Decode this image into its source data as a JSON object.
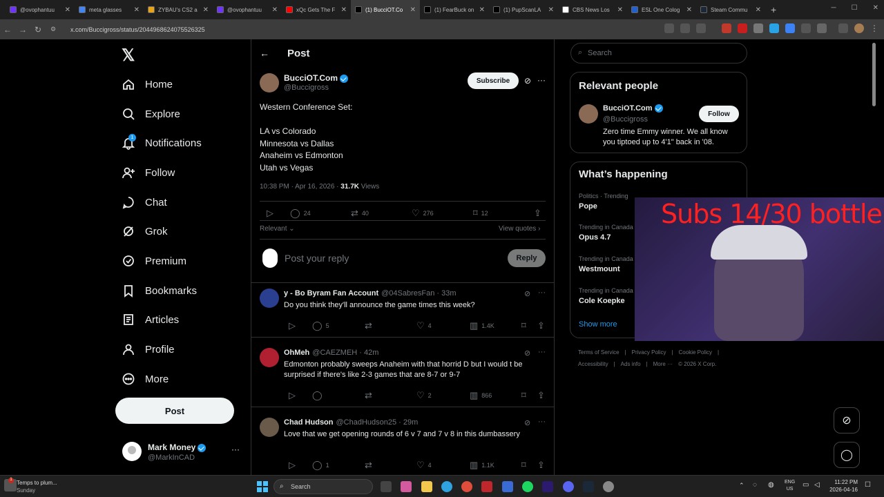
{
  "browser": {
    "tabs": [
      {
        "title": "@ovophantuu",
        "color": "#6e33ff"
      },
      {
        "title": "meta glasses",
        "color": "#4285f4"
      },
      {
        "title": "ZYBAU's CS2 a",
        "color": "#e8a317"
      },
      {
        "title": "@ovophantuu",
        "color": "#6e33ff"
      },
      {
        "title": "xQc Gets The F",
        "color": "#ff0000"
      },
      {
        "title": "(1) BucciOT.Co",
        "color": "#000000",
        "active": true
      },
      {
        "title": "(1) FearBuck on",
        "color": "#000000"
      },
      {
        "title": "(1) PupScanLA",
        "color": "#000000"
      },
      {
        "title": "CBS News Los",
        "color": "#ffffff"
      },
      {
        "title": "ESL One Colog",
        "color": "#2060d0"
      },
      {
        "title": "Steam Commu",
        "color": "#1b2838"
      }
    ],
    "url": "x.com/Buccigross/status/2044968624075526325"
  },
  "nav": {
    "logo": "𝕏",
    "items": [
      {
        "label": "Home",
        "icon": "home-icon"
      },
      {
        "label": "Explore",
        "icon": "search-icon"
      },
      {
        "label": "Notifications",
        "icon": "bell-icon",
        "badge": "1"
      },
      {
        "label": "Follow",
        "icon": "person-add-icon"
      },
      {
        "label": "Chat",
        "icon": "chat-icon"
      },
      {
        "label": "Grok",
        "icon": "grok-icon"
      },
      {
        "label": "Premium",
        "icon": "premium-icon"
      },
      {
        "label": "Bookmarks",
        "icon": "bookmark-icon"
      },
      {
        "label": "Articles",
        "icon": "articles-icon"
      },
      {
        "label": "Profile",
        "icon": "profile-icon"
      },
      {
        "label": "More",
        "icon": "more-circle-icon"
      }
    ],
    "post_label": "Post",
    "account": {
      "name": "Mark Money",
      "handle": "@MarkInCAD"
    }
  },
  "header": {
    "title": "Post"
  },
  "post": {
    "author": "BucciOT.Com",
    "handle": "@Buccigross",
    "subscribe": "Subscribe",
    "lines": [
      "Western Conference Set:",
      "",
      "LA vs Colorado",
      "Minnesota vs Dallas",
      "Anaheim vs Edmonton",
      "Utah vs Vegas"
    ],
    "timestamp": "10:38 PM · Apr 16, 2026 ·",
    "views_count": "31.7K",
    "views_label": "Views",
    "replies": "24",
    "reposts": "40",
    "likes": "276",
    "bookmarks": "12",
    "sort": "Relevant",
    "view_quotes": "View quotes"
  },
  "composer": {
    "placeholder": "Post your reply",
    "reply_label": "Reply"
  },
  "replies": [
    {
      "name": "y - Bo Byram Fan Account",
      "handle": "@04SabresFan · 33m",
      "text": "Do you think they'll announce the game times this week?",
      "replies": "5",
      "reposts": "",
      "likes": "4",
      "views": "1.4K"
    },
    {
      "name": "OhMeh",
      "handle": "@CAEZMEH · 42m",
      "text": "Edmonton probably sweeps Anaheim with that horrid D but I would t be surprised if there's like 2-3 games that are 8-7 or 9-7",
      "replies": "",
      "reposts": "",
      "likes": "2",
      "views": "866"
    },
    {
      "name": "Chad Hudson",
      "handle": "@ChadHudson25 · 29m",
      "text": "Love that we get opening rounds of 6 v 7 and 7 v 8 in this dumbassery",
      "replies": "1",
      "reposts": "",
      "likes": "4",
      "views": "1.1K"
    }
  ],
  "search": {
    "placeholder": "Search"
  },
  "relevant": {
    "title": "Relevant people",
    "name": "BucciOT.Com",
    "handle": "@Buccigross",
    "follow": "Follow",
    "bio": "Zero time Emmy winner. We all know you tiptoed up to 4'1\" back in '08."
  },
  "happening": {
    "title": "What’s happening",
    "trends": [
      {
        "context": "Politics · Trending",
        "name": "Pope"
      },
      {
        "context": "Trending in Canada",
        "name": "Opus 4.7"
      },
      {
        "context": "Trending in Canada",
        "name": "Westmount"
      },
      {
        "context": "Trending in Canada",
        "name": "Cole Koepke"
      }
    ],
    "show_more": "Show more"
  },
  "footer": {
    "links": [
      "Terms of Service",
      "|",
      "Privacy Policy",
      "|",
      "Cookie Policy",
      "|"
    ],
    "links2": [
      "Accessibility",
      "|",
      "Ads info",
      "|",
      "More ···",
      "© 2026 X Corp."
    ]
  },
  "webcam": {
    "overlay": "Subs 14/30 bottle"
  },
  "taskbar": {
    "weather_title": "Temps to plum...",
    "weather_sub": "Sunday",
    "search": "Search",
    "lang1": "ENG",
    "lang2": "US",
    "time": "11:22 PM",
    "date": "2026-04-16"
  }
}
